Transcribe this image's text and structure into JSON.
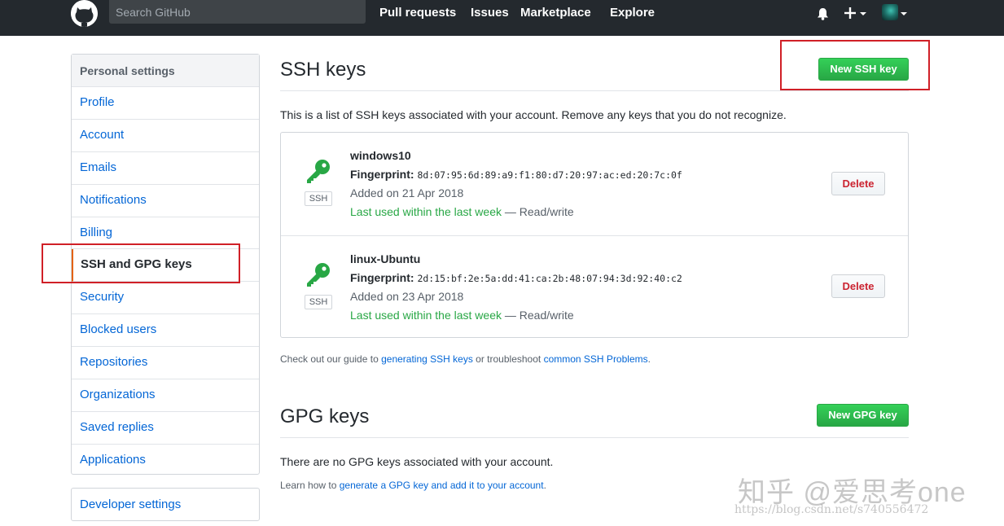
{
  "header": {
    "logo_icon": "octocat-icon",
    "search_placeholder": "Search GitHub",
    "nav": [
      "Pull requests",
      "Issues",
      "Marketplace",
      "Explore"
    ],
    "bell_icon": "bell-icon",
    "plus_icon": "plus-icon"
  },
  "sidebar": {
    "heading": "Personal settings",
    "items": [
      {
        "label": "Profile"
      },
      {
        "label": "Account"
      },
      {
        "label": "Emails"
      },
      {
        "label": "Notifications"
      },
      {
        "label": "Billing"
      },
      {
        "label": "SSH and GPG keys",
        "selected": true
      },
      {
        "label": "Security"
      },
      {
        "label": "Blocked users"
      },
      {
        "label": "Repositories"
      },
      {
        "label": "Organizations"
      },
      {
        "label": "Saved replies"
      },
      {
        "label": "Applications"
      }
    ],
    "developer_settings": "Developer settings"
  },
  "ssh": {
    "title": "SSH keys",
    "new_button": "New SSH key",
    "intro": "This is a list of SSH keys associated with your account. Remove any keys that you do not recognize.",
    "keys": [
      {
        "name": "windows10",
        "fingerprint_label": "Fingerprint:",
        "fingerprint": "8d:07:95:6d:89:a9:f1:80:d7:20:97:ac:ed:20:7c:0f",
        "added": "Added on 21 Apr 2018",
        "last_used": "Last used within the last week",
        "access": "— Read/write",
        "type_label": "SSH",
        "delete_label": "Delete"
      },
      {
        "name": "linux-Ubuntu",
        "fingerprint_label": "Fingerprint:",
        "fingerprint": "2d:15:bf:2e:5a:dd:41:ca:2b:48:07:94:3d:92:40:c2",
        "added": "Added on 23 Apr 2018",
        "last_used": "Last used within the last week",
        "access": "— Read/write",
        "type_label": "SSH",
        "delete_label": "Delete"
      }
    ],
    "guide": {
      "prefix": "Check out our guide to",
      "link1": "generating SSH keys",
      "middle": "or troubleshoot",
      "link2": "common SSH Problems",
      "suffix": "."
    }
  },
  "gpg": {
    "title": "GPG keys",
    "new_button": "New GPG key",
    "empty": "There are no GPG keys associated with your account.",
    "learn_prefix": "Learn how to",
    "learn_link": "generate a GPG key and add it to your account",
    "learn_suffix": "."
  },
  "watermark": {
    "text": "知乎 @爱思考one",
    "url": "https://blog.csdn.net/s740556472"
  },
  "colors": {
    "header_bg": "#24292e",
    "link": "#0366d6",
    "green": "#28a745",
    "danger": "#cb2431",
    "annotation_red": "#d02027",
    "selected_border": "#e36209"
  }
}
